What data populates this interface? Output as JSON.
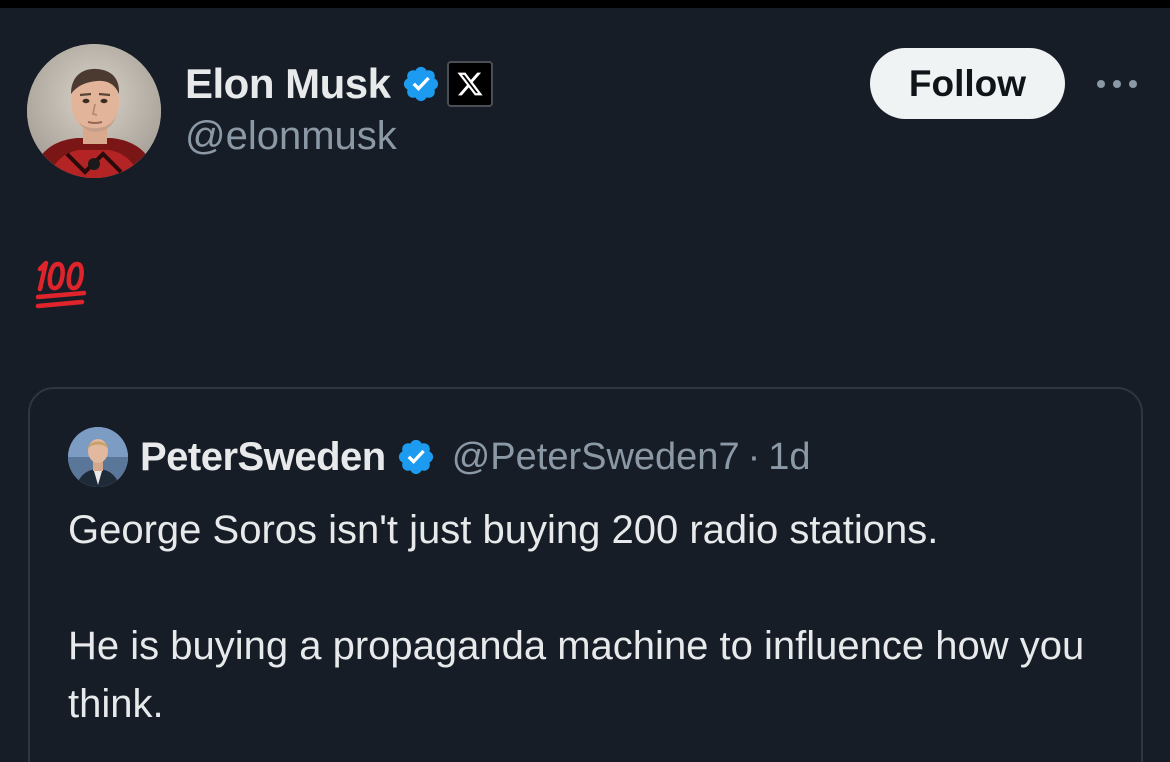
{
  "author": {
    "display_name": "Elon Musk",
    "handle": "@elonmusk",
    "verified_icon": "verified-badge-icon",
    "affiliation_icon": "x-logo-icon",
    "avatar": "avatar-elon-musk"
  },
  "actions": {
    "follow_label": "Follow",
    "more_icon": "more-options-icon"
  },
  "tweet": {
    "body_emoji": "hundred-points-emoji"
  },
  "quoted_tweet": {
    "display_name": "PeterSweden",
    "handle": "@PeterSweden7",
    "separator": "·",
    "time": "1d",
    "text_paragraphs": [
      "George Soros isn't just buying 200 radio stations.",
      "He is buying a propaganda machine to influence how you think."
    ]
  },
  "colors": {
    "background": "#161d27",
    "verified_blue": "#1d9bf0",
    "primary_text": "#e7e9ea",
    "secondary_text": "#8b98a5",
    "emoji_red": "#e0242c",
    "follow_button_bg": "#eff3f4"
  }
}
